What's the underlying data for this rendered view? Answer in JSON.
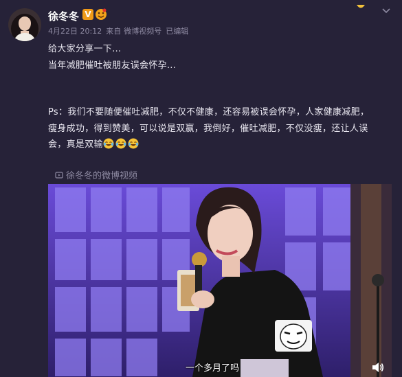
{
  "post": {
    "author": "徐冬冬",
    "verified_badge": "V",
    "timestamp": "4月22日 20:12",
    "source_prefix": "来自",
    "source": "微博视频号",
    "edited": "已编辑",
    "lines": [
      "给大家分享一下…",
      "当年减肥催吐被朋友误会怀孕…",
      "Ps：我们不要随便催吐减肥，不仅不健康，还容易被误会怀孕，人家健康减肥，",
      "瘦身成功，得到赞美，可以说是双赢，我倒好，催吐减肥，不仅没瘦，还让人误",
      "会，真是双输"
    ],
    "trailing_emoji": [
      "laugh-cry-emoji",
      "laugh-cry-emoji",
      "laugh-cry-emoji"
    ],
    "video_link": "徐冬冬的微博视频"
  },
  "video": {
    "subtitle": "一个多月了吗",
    "icons": [
      "volume-icon",
      "meme-sticker"
    ]
  },
  "colors": {
    "background": "#262238",
    "text": "#e8e6ef",
    "muted": "#8e8aa2",
    "badge": "#f09a18"
  }
}
